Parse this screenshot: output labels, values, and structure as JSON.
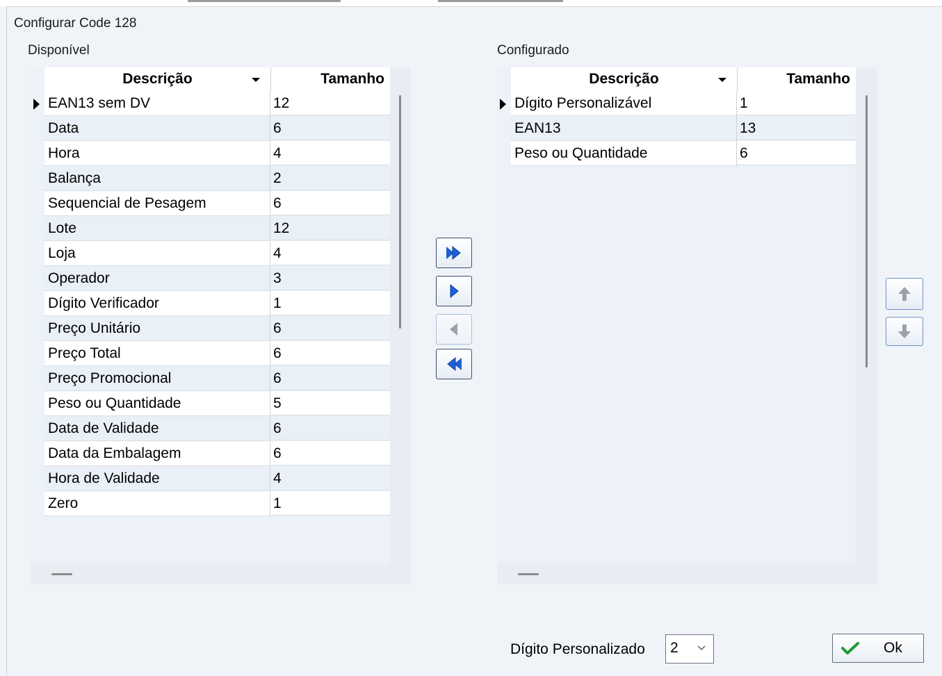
{
  "window": {
    "title": "Configurar Code 128"
  },
  "available": {
    "label": "Disponível",
    "columns": [
      "Descrição",
      "Tamanho"
    ],
    "rows": [
      [
        "EAN13 sem DV",
        "12"
      ],
      [
        "Data",
        "6"
      ],
      [
        "Hora",
        "4"
      ],
      [
        "Balança",
        "2"
      ],
      [
        "Sequencial de Pesagem",
        "6"
      ],
      [
        "Lote",
        "12"
      ],
      [
        "Loja",
        "4"
      ],
      [
        "Operador",
        "3"
      ],
      [
        "Dígito Verificador",
        "1"
      ],
      [
        "Preço Unitário",
        "6"
      ],
      [
        "Preço Total",
        "6"
      ],
      [
        "Preço Promocional",
        "6"
      ],
      [
        "Peso ou Quantidade",
        "5"
      ],
      [
        "Data de Validade",
        "6"
      ],
      [
        "Data da Embalagem",
        "6"
      ],
      [
        "Hora de Validade",
        "4"
      ],
      [
        "Zero",
        "1"
      ]
    ],
    "selected_row": 0
  },
  "configured": {
    "label": "Configurado",
    "columns": [
      "Descrição",
      "Tamanho"
    ],
    "rows": [
      [
        "Dígito Personalizável",
        "1"
      ],
      [
        "EAN13",
        "13"
      ],
      [
        "Peso ou Quantidade",
        "6"
      ]
    ],
    "selected_row": 0
  },
  "transfer_buttons": [
    {
      "icon": "double-arrow-right-icon",
      "enabled": true
    },
    {
      "icon": "arrow-right-icon",
      "enabled": true
    },
    {
      "icon": "arrow-left-icon",
      "enabled": false
    },
    {
      "icon": "double-arrow-left-icon",
      "enabled": true
    }
  ],
  "order_buttons": [
    {
      "icon": "arrow-up-icon"
    },
    {
      "icon": "arrow-down-icon"
    }
  ],
  "footer": {
    "digit_label": "Dígito Personalizado",
    "digit_value": "2",
    "ok_label": "Ok"
  },
  "colors": {
    "arrow_blue": "#1f5fd6",
    "arrow_gray": "#9aa1ab",
    "check_green": "#1e9b32"
  }
}
